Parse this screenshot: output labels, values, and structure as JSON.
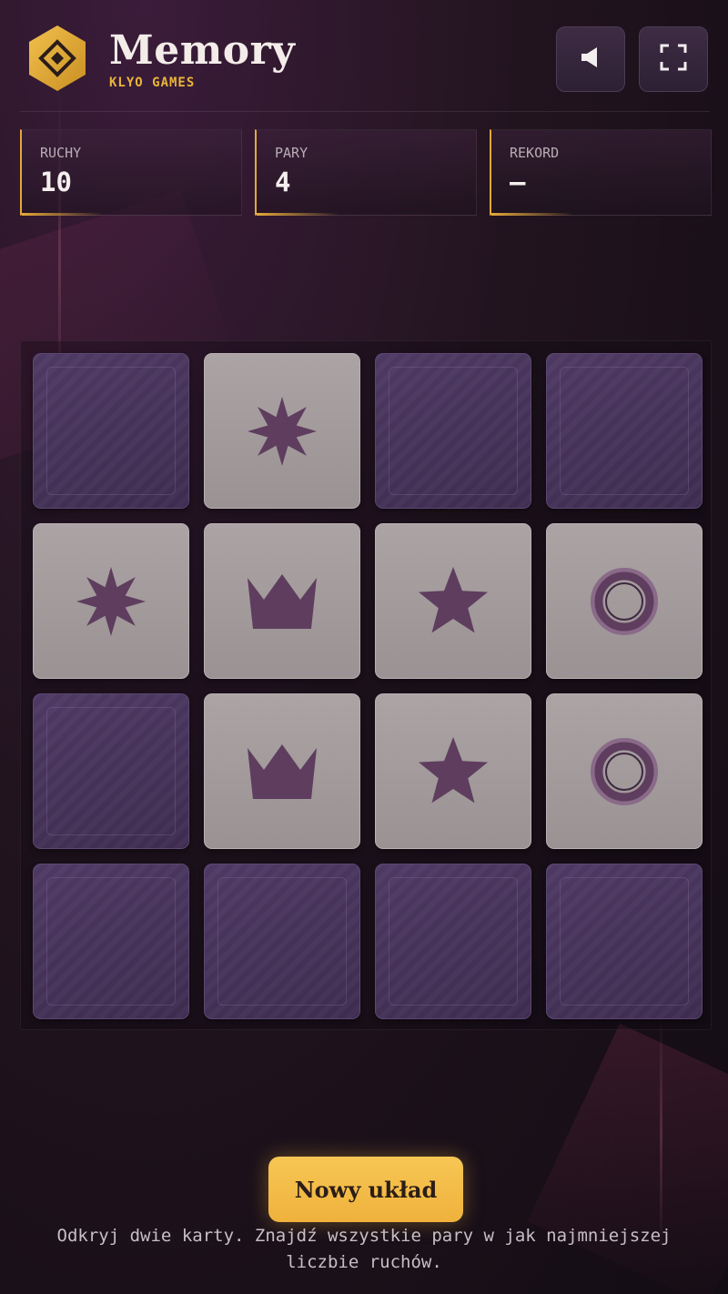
{
  "header": {
    "title": "Memory",
    "subtitle": "KLYO GAMES",
    "logo_icon": "diamond-hexagon-icon",
    "buttons": [
      {
        "name": "sound-button",
        "icon": "speaker-icon"
      },
      {
        "name": "fullscreen-button",
        "icon": "fullscreen-icon"
      }
    ]
  },
  "stats": {
    "moves": {
      "label": "RUCHY",
      "value": "10"
    },
    "pairs": {
      "label": "PARY",
      "value": "4"
    },
    "record": {
      "label": "REKORD",
      "value": "—"
    }
  },
  "board": {
    "rows": 4,
    "cols": 4,
    "cards": [
      {
        "state": "down",
        "symbol": null
      },
      {
        "state": "up",
        "symbol": "burst-star"
      },
      {
        "state": "down",
        "symbol": null
      },
      {
        "state": "down",
        "symbol": null
      },
      {
        "state": "up",
        "symbol": "burst-star"
      },
      {
        "state": "up",
        "symbol": "crown"
      },
      {
        "state": "up",
        "symbol": "star"
      },
      {
        "state": "up",
        "symbol": "ring"
      },
      {
        "state": "down",
        "symbol": null
      },
      {
        "state": "up",
        "symbol": "crown"
      },
      {
        "state": "up",
        "symbol": "star"
      },
      {
        "state": "up",
        "symbol": "ring"
      },
      {
        "state": "down",
        "symbol": null
      },
      {
        "state": "down",
        "symbol": null
      },
      {
        "state": "down",
        "symbol": null
      },
      {
        "state": "down",
        "symbol": null
      }
    ]
  },
  "footer": {
    "new_game_label": "Nowy układ",
    "hint_line1": "Odkryj dwie karty. Znajdź wszystkie pary w jak najmniejszej",
    "hint_line2": "liczbie ruchów."
  },
  "colors": {
    "accent": "#e9b53a",
    "card_back": "#4a3660",
    "card_face": "#a39b9c",
    "symbol": "#5e3d5e"
  }
}
